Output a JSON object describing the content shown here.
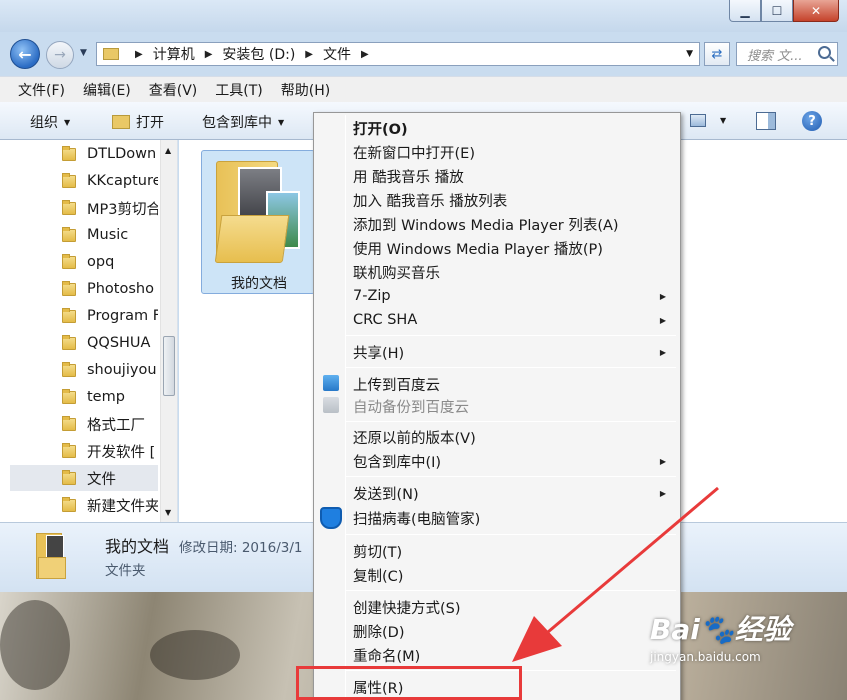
{
  "window": {
    "address": {
      "segments": [
        "计算机",
        "安装包 (D:)",
        "文件"
      ]
    },
    "search_placeholder": "搜索 文...",
    "menu": [
      "文件(F)",
      "编辑(E)",
      "查看(V)",
      "工具(T)",
      "帮助(H)"
    ],
    "toolbar": {
      "organize": "组织",
      "open": "打开",
      "include_library": "包含到库中"
    }
  },
  "navpane": {
    "items": [
      "DTLDown",
      "KKcapture",
      "MP3剪切合",
      "Music",
      "opq",
      "Photosho",
      "Program F",
      "QQSHUA",
      "shoujiyou",
      "temp",
      "格式工厂",
      "开发软件 [",
      "文件",
      "新建文件夹"
    ],
    "selected": "文件"
  },
  "content": {
    "file_label": "我的文档"
  },
  "details": {
    "name": "我的文档",
    "meta": "修改日期: 2016/3/1",
    "type": "文件夹"
  },
  "context_menu": {
    "groups": [
      [
        {
          "label": "打开(O)",
          "bold": true
        },
        {
          "label": "在新窗口中打开(E)"
        },
        {
          "label": "用 酷我音乐 播放"
        },
        {
          "label": "加入 酷我音乐 播放列表"
        },
        {
          "label": "添加到 Windows Media Player 列表(A)"
        },
        {
          "label": "使用 Windows Media Player 播放(P)"
        },
        {
          "label": "联机购买音乐"
        },
        {
          "label": "7-Zip",
          "submenu": true
        },
        {
          "label": "CRC SHA",
          "submenu": true
        }
      ],
      [
        {
          "label": "共享(H)",
          "submenu": true
        }
      ],
      [
        {
          "label": "上传到百度云",
          "icon": "cloud-upload-icon"
        },
        {
          "label": "自动备份到百度云",
          "icon": "cloud-backup-icon",
          "disabled": true
        }
      ],
      [
        {
          "label": "还原以前的版本(V)"
        },
        {
          "label": "包含到库中(I)",
          "submenu": true
        }
      ],
      [
        {
          "label": "发送到(N)",
          "submenu": true
        },
        {
          "label": "扫描病毒(电脑管家)",
          "icon": "shield-icon"
        }
      ],
      [
        {
          "label": "剪切(T)"
        },
        {
          "label": "复制(C)"
        }
      ],
      [
        {
          "label": "创建快捷方式(S)"
        },
        {
          "label": "删除(D)"
        },
        {
          "label": "重命名(M)"
        }
      ],
      [
        {
          "label": "属性(R)"
        }
      ]
    ]
  },
  "annotation": {
    "highlight_color": "#e83a3a",
    "target": "属性(R)"
  },
  "watermark": {
    "logo": "Bai🐾经验",
    "url": "jingyan.baidu.com"
  }
}
